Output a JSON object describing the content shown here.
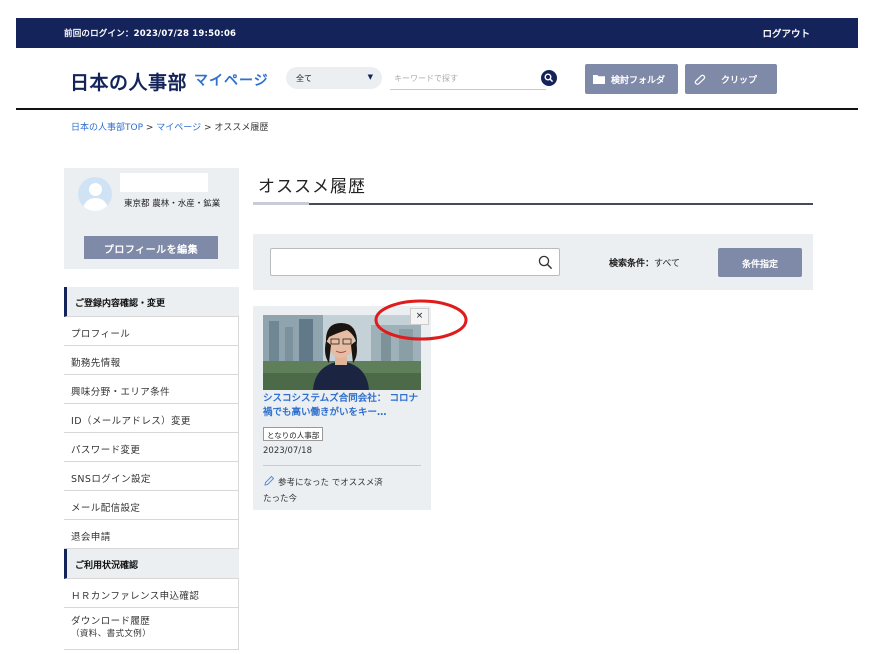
{
  "topbar": {
    "last_login": "前回のログイン：2023/07/28 19:50:06",
    "logout": "ログアウト"
  },
  "header": {
    "logo": "日本の人事部",
    "logo_sub": "マイページ",
    "category_select": "全て",
    "search_placeholder": "キーワードで探す",
    "folder_button": "検討フォルダ",
    "clip_button": "クリップ"
  },
  "breadcrumb": {
    "items": [
      "日本の人事部TOP",
      "マイページ"
    ],
    "separator": " > ",
    "current": "オススメ履歴"
  },
  "profile": {
    "location": "東京都 農林・水産・鉱業",
    "edit_button": "プロフィールを編集"
  },
  "sidebar": {
    "section1": "ご登録内容確認・変更",
    "items": [
      "プロフィール",
      "勤務先情報",
      "興味分野・エリア条件",
      "ID（メールアドレス）変更",
      "パスワード変更",
      "SNSログイン設定",
      "メール配信設定",
      "退会申請"
    ],
    "section2": "ご利用状況確認",
    "items2": [
      "ＨＲカンファレンス申込確認"
    ],
    "download": "ダウンロード履歴",
    "download_sub": "（資料、書式文例）"
  },
  "main": {
    "title": "オススメ履歴",
    "condition_label": "検索条件：",
    "condition_value": "すべて",
    "condition_button": "条件指定"
  },
  "card": {
    "close": "×",
    "title": "シスコシステムズ合同会社： コロナ禍でも高い働きがいをキー…",
    "tag": "となりの人事部",
    "date": "2023/07/18",
    "note_strong": "参考になった",
    "note_rest": " でオススメ済",
    "note_time": "たった今"
  },
  "colors": {
    "navy": "#14245a",
    "link": "#2f6fce",
    "button": "#7f89a8",
    "panel": "#eceff2",
    "annotation": "#e01b1b"
  }
}
